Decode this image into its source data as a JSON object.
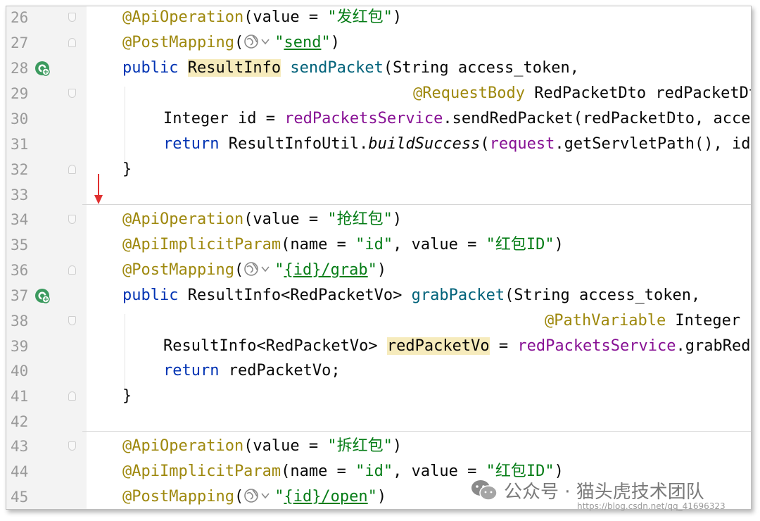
{
  "editor": {
    "lines": [
      {
        "n": "26"
      },
      {
        "n": "27"
      },
      {
        "n": "28"
      },
      {
        "n": "29"
      },
      {
        "n": "30"
      },
      {
        "n": "31"
      },
      {
        "n": "32"
      },
      {
        "n": "33"
      },
      {
        "n": "34"
      },
      {
        "n": "35"
      },
      {
        "n": "36"
      },
      {
        "n": "37"
      },
      {
        "n": "38"
      },
      {
        "n": "39"
      },
      {
        "n": "40"
      },
      {
        "n": "41"
      },
      {
        "n": "42"
      },
      {
        "n": "43"
      },
      {
        "n": "44"
      },
      {
        "n": "45"
      }
    ],
    "tokens": {
      "l26": {
        "ann": "@ApiOperation",
        "a": "(value = ",
        "s": "\"发红包\"",
        "b": ")"
      },
      "l27": {
        "ann": "@PostMapping",
        "a": "(",
        "q1": "\"",
        "link": "send",
        "q2": "\"",
        "b": ")"
      },
      "l28": {
        "kw": "public ",
        "type": "ResultInfo",
        "sp": " ",
        "fn": "sendPacket",
        "a": "(String access_token,"
      },
      "l29": {
        "ann": "@RequestBody",
        "a": " RedPacketDto redPacketDto"
      },
      "l30": {
        "a": "Integer id = ",
        "fld": "redPacketsService",
        "b": ".sendRedPacket(redPacketDto, access_token);"
      },
      "l31": {
        "kw": "return ",
        "a": "ResultInfoUtil.",
        "it": "buildSuccess",
        "b": "(",
        "fld": "request",
        "c": ".getServletPath(), id);"
      },
      "l32": {
        "a": "}"
      },
      "l34": {
        "ann": "@ApiOperation",
        "a": "(value = ",
        "s": "\"抢红包\"",
        "b": ")"
      },
      "l35": {
        "ann": "@ApiImplicitParam",
        "a": "(name = ",
        "s1": "\"id\"",
        "b": ", value = ",
        "s2": "\"红包ID\"",
        "c": ")"
      },
      "l36": {
        "ann": "@PostMapping",
        "a": "(",
        "q1": "\"",
        "link": "{id}/grab",
        "q2": "\"",
        "b": ")"
      },
      "l37": {
        "kw": "public ",
        "a": "ResultInfo<RedPacketVo> ",
        "fn": "grabPacket",
        "b": "(String access_token,"
      },
      "l38": {
        "ann": "@PathVariable",
        "a": " Integer id) {"
      },
      "l39": {
        "a": "ResultInfo<RedPacketVo> ",
        "var": "redPacketVo",
        "b": " = ",
        "fld": "redPacketsService",
        "c": ".grabRedPacket(id, access_token);"
      },
      "l40": {
        "kw": "return ",
        "a": "redPacketVo;"
      },
      "l41": {
        "a": "}"
      },
      "l43": {
        "ann": "@ApiOperation",
        "a": "(value = ",
        "s": "\"拆红包\"",
        "b": ")"
      },
      "l44": {
        "ann": "@ApiImplicitParam",
        "a": "(name = ",
        "s1": "\"id\"",
        "b": ", value = ",
        "s2": "\"红包ID\"",
        "c": ")"
      },
      "l45": {
        "ann": "@PostMapping",
        "a": "(",
        "q1": "\"",
        "link": "{id}/open",
        "q2": "\"",
        "b": ")"
      }
    }
  },
  "watermark": {
    "text": "公众号 · 猫头虎技术团队",
    "url": "https://blog.csdn.net/qq_41696323",
    "icon": "wechat-icon"
  },
  "colors": {
    "annotation": "#9e880d",
    "keyword": "#0033b3",
    "string": "#067d17",
    "method": "#00627a",
    "field": "#871094",
    "highlight": "#f6ebbc",
    "arrow": "#e03030"
  }
}
